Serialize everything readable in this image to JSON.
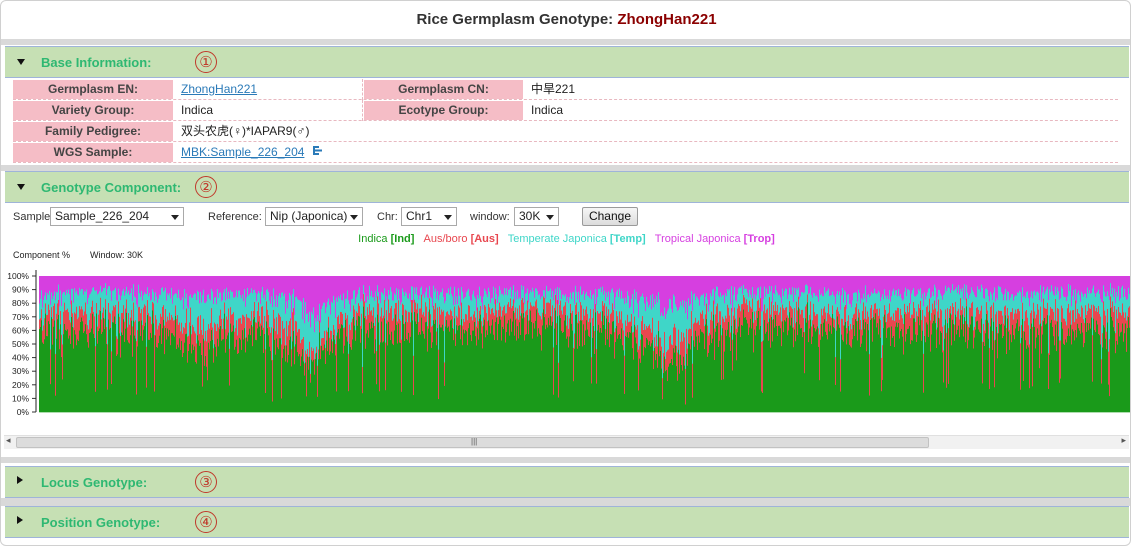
{
  "page": {
    "title_prefix": "Rice Germplasm Genotype: ",
    "title_name": "ZhongHan221"
  },
  "sections": {
    "base": {
      "label": "Base Information:",
      "num": "①"
    },
    "genotype": {
      "label": "Genotype Component:",
      "num": "②"
    },
    "locus": {
      "label": "Locus Genotype:",
      "num": "③"
    },
    "position": {
      "label": "Position Genotype:",
      "num": "④"
    }
  },
  "info": {
    "germplasm_en_key": "Germplasm EN:",
    "germplasm_en_val": "ZhongHan221",
    "germplasm_cn_key": "Germplasm CN:",
    "germplasm_cn_val": "中旱221",
    "variety_group_key": "Variety Group:",
    "variety_group_val": "Indica",
    "ecotype_group_key": "Ecotype Group:",
    "ecotype_group_val": "Indica",
    "family_pedigree_key": "Family Pedigree:",
    "family_pedigree_val": "双头农虎(♀)*IAPAR9(♂)",
    "wgs_sample_key": "WGS Sample:",
    "wgs_sample_val": "MBK:Sample_226_204"
  },
  "controls": {
    "sample_label": "Sample:",
    "sample_value": "Sample_226_204",
    "reference_label": "Reference:",
    "reference_value": "Nip (Japonica)",
    "chr_label": "Chr:",
    "chr_value": "Chr1",
    "window_label": "window:",
    "window_value": "30K",
    "change_button": "Change"
  },
  "legend": {
    "indica": "Indica ",
    "indica_code": "[Ind]",
    "aus": "Aus/boro ",
    "aus_code": "[Aus]",
    "temp": "Temperate Japonica ",
    "temp_code": "[Temp]",
    "trop": "Tropical Japonica ",
    "trop_code": "[Trop]",
    "colors": {
      "indica": "#1a9a1a",
      "aus": "#e8474f",
      "temp": "#3fd6c8",
      "trop": "#d63fe0"
    }
  },
  "chart_labels": {
    "ylabel": "Component %",
    "window": "Window: 30K"
  },
  "chart_data": {
    "type": "area",
    "stacked": true,
    "yticks": [
      "100%",
      "90%",
      "80%",
      "70%",
      "60%",
      "50%",
      "40%",
      "30%",
      "20%",
      "10%",
      "0%"
    ],
    "ylim": [
      0,
      100
    ],
    "series": [
      {
        "name": "Indica [Ind]",
        "color": "#1a9a1a"
      },
      {
        "name": "Aus/boro [Aus]",
        "color": "#e8474f"
      },
      {
        "name": "Temperate Japonica [Temp]",
        "color": "#3fd6c8"
      },
      {
        "name": "Tropical Japonica [Trop]",
        "color": "#d63fe0"
      }
    ],
    "profile": [
      [
        0.0,
        62,
        10,
        12,
        16
      ],
      [
        0.03,
        55,
        18,
        15,
        12
      ],
      [
        0.06,
        58,
        12,
        18,
        12
      ],
      [
        0.1,
        60,
        14,
        14,
        12
      ],
      [
        0.15,
        50,
        15,
        20,
        15
      ],
      [
        0.2,
        60,
        12,
        16,
        12
      ],
      [
        0.23,
        45,
        20,
        15,
        20
      ],
      [
        0.25,
        35,
        8,
        28,
        29
      ],
      [
        0.28,
        58,
        12,
        14,
        16
      ],
      [
        0.33,
        62,
        16,
        10,
        12
      ],
      [
        0.38,
        60,
        10,
        16,
        14
      ],
      [
        0.45,
        64,
        14,
        10,
        12
      ],
      [
        0.52,
        60,
        12,
        14,
        14
      ],
      [
        0.56,
        45,
        12,
        22,
        21
      ],
      [
        0.58,
        30,
        18,
        28,
        24
      ],
      [
        0.61,
        56,
        14,
        16,
        14
      ],
      [
        0.66,
        62,
        16,
        10,
        12
      ],
      [
        0.72,
        58,
        12,
        16,
        14
      ],
      [
        0.8,
        62,
        14,
        12,
        12
      ],
      [
        0.86,
        60,
        12,
        16,
        12
      ],
      [
        0.92,
        58,
        16,
        14,
        12
      ],
      [
        1.0,
        60,
        14,
        14,
        12
      ]
    ]
  }
}
